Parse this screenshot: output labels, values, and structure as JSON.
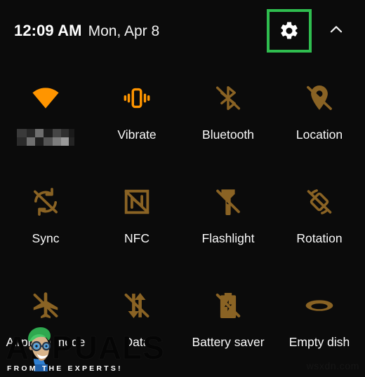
{
  "colors": {
    "background": "#0b0b0b",
    "accent_active": "#ff9500",
    "accent_inactive": "#8a6324",
    "highlight_box": "#2fbd4f",
    "label_text": "#fafafa"
  },
  "header": {
    "time": "12:09 AM",
    "date": "Mon, Apr 8",
    "settings_icon": "gear-icon",
    "collapse_icon": "chevron-up-icon"
  },
  "tiles": [
    {
      "label": "",
      "icon": "wifi-icon",
      "state": "on",
      "redacted": true
    },
    {
      "label": "Vibrate",
      "icon": "vibrate-icon",
      "state": "on",
      "redacted": false
    },
    {
      "label": "Bluetooth",
      "icon": "bluetooth-off-icon",
      "state": "off",
      "redacted": false
    },
    {
      "label": "Location",
      "icon": "location-off-icon",
      "state": "off",
      "redacted": false
    },
    {
      "label": "Sync",
      "icon": "sync-off-icon",
      "state": "off",
      "redacted": false
    },
    {
      "label": "NFC",
      "icon": "nfc-off-icon",
      "state": "off",
      "redacted": false
    },
    {
      "label": "Flashlight",
      "icon": "flashlight-off-icon",
      "state": "off",
      "redacted": false
    },
    {
      "label": "Rotation",
      "icon": "rotation-off-icon",
      "state": "off",
      "redacted": false
    },
    {
      "label": "Airplane mode",
      "icon": "airplane-off-icon",
      "state": "off",
      "redacted": false
    },
    {
      "label": "Data",
      "icon": "mobile-data-off-icon",
      "state": "off",
      "redacted": false
    },
    {
      "label": "Battery saver",
      "icon": "battery-saver-off-icon",
      "state": "off",
      "redacted": false
    },
    {
      "label": "Empty dish",
      "icon": "empty-dish-icon",
      "state": "off",
      "redacted": false
    }
  ],
  "watermark": {
    "brand": "APPUALS",
    "tagline": "FROM THE EXPERTS!",
    "corner": "wsxdn.com"
  }
}
